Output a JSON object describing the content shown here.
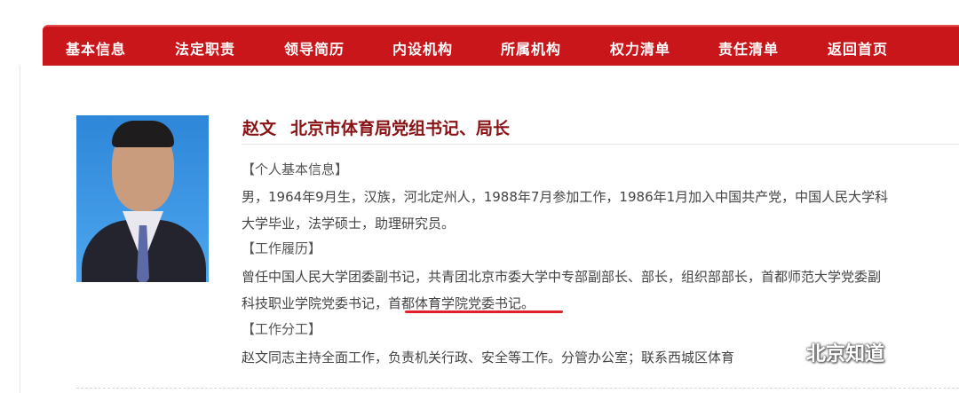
{
  "nav": {
    "items": [
      "基本信息",
      "法定职责",
      "领导简历",
      "内设机构",
      "所属机构",
      "权力清单",
      "责任清单",
      "返回首页"
    ]
  },
  "profile": {
    "name": "赵文",
    "title": "北京市体育局党组书记、局长",
    "sections": [
      {
        "heading": "【个人基本信息】",
        "lines": [
          "男，1964年9月生，汉族，河北定州人，1988年7月参加工作，1986年1月加入中国共产党，中国人民大学科",
          "大学毕业，法学硕士，助理研究员。"
        ]
      },
      {
        "heading": "【工作履历】",
        "lines": [
          "曾任中国人民大学团委副书记，共青团北京市委大学中专部副部长、部长，组织部部长，首都师范大学党委副",
          "科技职业学院党委书记，首都体育学院党委书记。"
        ]
      },
      {
        "heading": "【工作分工】",
        "lines": [
          "赵文同志主持全面工作，负责机关行政、安全等工作。分管办公室；联系西城区体育"
        ]
      }
    ]
  },
  "watermark": {
    "text": "北京知道"
  },
  "colors": {
    "nav_bg": "#c9161a",
    "name_color": "#8a1214",
    "underline": "#e0202a"
  }
}
